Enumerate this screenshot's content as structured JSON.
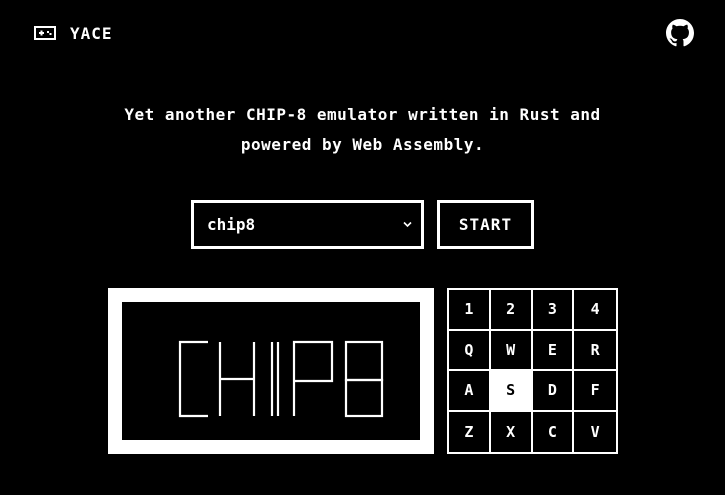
{
  "header": {
    "brand_icon": "gamepad-icon",
    "brand_name": "YACE",
    "repo_icon": "github-icon"
  },
  "tagline": {
    "line1": "Yet another CHIP-8 emulator written in Rust and",
    "line2": "powered by Web Assembly."
  },
  "controls": {
    "rom_select": {
      "selected_value": "chip8",
      "icon": "chevron-down-icon"
    },
    "start_label": "START"
  },
  "screen": {
    "display_text": "CHIP8",
    "colors": {
      "foreground": "#ffffff",
      "background": "#000000"
    }
  },
  "keypad": {
    "rows": [
      [
        "1",
        "2",
        "3",
        "4"
      ],
      [
        "Q",
        "W",
        "E",
        "R"
      ],
      [
        "A",
        "S",
        "D",
        "F"
      ],
      [
        "Z",
        "X",
        "C",
        "V"
      ]
    ],
    "pressed_key": "S"
  }
}
